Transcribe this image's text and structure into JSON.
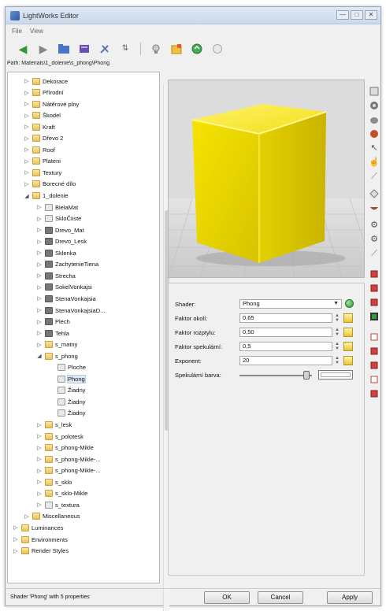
{
  "window": {
    "title": "LightWorks Editor",
    "controls": [
      "—",
      "□",
      "✕"
    ]
  },
  "menu": [
    "File",
    "View"
  ],
  "toolbar": {
    "icons": [
      "back-arrow-icon",
      "forward-arrow-icon",
      "open-folder-icon",
      "database-icon",
      "tools-icon",
      "sort-icon",
      "bulb-icon",
      "folder-new-icon",
      "refresh-icon",
      "disabled-icon"
    ]
  },
  "path": "Path: Materials\\1_dolenie\\s_phong\\Phong",
  "tree": {
    "items": [
      {
        "label": "Dekorace",
        "level": 2,
        "icon": "folder",
        "expander": "▷"
      },
      {
        "label": "Přírodní",
        "level": 2,
        "icon": "folder",
        "expander": "▷"
      },
      {
        "label": "Nátěrové plny",
        "level": 2,
        "icon": "folder",
        "expander": "▷"
      },
      {
        "label": "Škodel",
        "level": 2,
        "icon": "folder",
        "expander": "▷"
      },
      {
        "label": "Kraft",
        "level": 2,
        "icon": "folder",
        "expander": "▷"
      },
      {
        "label": "Dřevo 2",
        "level": 2,
        "icon": "folder",
        "expander": "▷"
      },
      {
        "label": "Roof",
        "level": 2,
        "icon": "folder",
        "expander": "▷"
      },
      {
        "label": "Plateni",
        "level": 2,
        "icon": "folder",
        "expander": "▷"
      },
      {
        "label": "Textury",
        "level": 2,
        "icon": "folder",
        "expander": "▷"
      },
      {
        "label": "Borecné dílo",
        "level": 2,
        "icon": "folder",
        "expander": "▷"
      },
      {
        "label": "1_dolenie",
        "level": 2,
        "icon": "folder",
        "expander": "◢"
      },
      {
        "label": "BielaMat",
        "level": 3,
        "icon": "sub",
        "expander": "▷"
      },
      {
        "label": "SkloČiiste",
        "level": 3,
        "icon": "sub",
        "expander": "▷"
      },
      {
        "label": "Drevo_Mat",
        "level": 3,
        "icon": "mat",
        "expander": "▷"
      },
      {
        "label": "Drevo_Lesk",
        "level": 3,
        "icon": "mat",
        "expander": "▷"
      },
      {
        "label": "Sklenka",
        "level": 3,
        "icon": "mat",
        "expander": "▷"
      },
      {
        "label": "ZachytenieTiena",
        "level": 3,
        "icon": "mat",
        "expander": "▷"
      },
      {
        "label": "Strecha",
        "level": 3,
        "icon": "mat",
        "expander": "▷"
      },
      {
        "label": "SokelVonkajsi",
        "level": 3,
        "icon": "mat",
        "expander": "▷"
      },
      {
        "label": "StenaVonkajsia",
        "level": 3,
        "icon": "mat",
        "expander": "▷"
      },
      {
        "label": "StenaVonkajsiaD...",
        "level": 3,
        "icon": "mat",
        "expander": "▷"
      },
      {
        "label": "Plech",
        "level": 3,
        "icon": "mat",
        "expander": "▷"
      },
      {
        "label": "Tehla",
        "level": 3,
        "icon": "mat",
        "expander": "▷"
      },
      {
        "label": "s_matny",
        "level": 3,
        "icon": "folder",
        "expander": "▷"
      },
      {
        "label": "s_phong",
        "level": 3,
        "icon": "folder",
        "expander": "◢"
      },
      {
        "label": "Ploche",
        "level": 4,
        "icon": "sub",
        "expander": ""
      },
      {
        "label": "Phong",
        "level": 4,
        "icon": "sub",
        "expander": "",
        "selected": true
      },
      {
        "label": "Žiadny",
        "level": 4,
        "icon": "sub",
        "expander": ""
      },
      {
        "label": "Žiadny",
        "level": 4,
        "icon": "sub",
        "expander": ""
      },
      {
        "label": "Žiadny",
        "level": 4,
        "icon": "sub",
        "expander": ""
      },
      {
        "label": "s_lesk",
        "level": 3,
        "icon": "folder",
        "expander": "▷"
      },
      {
        "label": "s_polotesk",
        "level": 3,
        "icon": "folder",
        "expander": "▷"
      },
      {
        "label": "s_phong-Mikle",
        "level": 3,
        "icon": "folder",
        "expander": "▷"
      },
      {
        "label": "s_phong-Mikle-...",
        "level": 3,
        "icon": "folder",
        "expander": "▷"
      },
      {
        "label": "s_phong-Mikle-...",
        "level": 3,
        "icon": "folder",
        "expander": "▷"
      },
      {
        "label": "s_sklo",
        "level": 3,
        "icon": "folder",
        "expander": "▷"
      },
      {
        "label": "s_sklo-Mikle",
        "level": 3,
        "icon": "folder",
        "expander": "▷"
      },
      {
        "label": "s_textura",
        "level": 3,
        "icon": "sub",
        "expander": "▷"
      },
      {
        "label": "Miscellaneous",
        "level": 2,
        "icon": "folder",
        "expander": "▷"
      },
      {
        "label": "Luminances",
        "level": 1,
        "icon": "folder",
        "expander": "▷"
      },
      {
        "label": "Environments",
        "level": 1,
        "icon": "folder",
        "expander": "▷"
      },
      {
        "label": "Render Styles",
        "level": 1,
        "icon": "folder",
        "expander": "▷"
      }
    ]
  },
  "properties": {
    "shader_label": "Shader:",
    "shader_value": "Phong",
    "rows": [
      {
        "label": "Faktor okolí:",
        "value": "0,65"
      },
      {
        "label": "Faktor rozptylu:",
        "value": "0,50"
      },
      {
        "label": "Faktor spekulární:",
        "value": "0,5"
      },
      {
        "label": "Exponent:",
        "value": "20"
      }
    ],
    "specular_color_label": "Spekulární barva:",
    "specular_slider": 0.92
  },
  "status": {
    "text": "Shader 'Phong' with 5 properties",
    "ok": "OK",
    "cancel": "Cancel",
    "apply": "Apply"
  },
  "right_toolbar": {
    "icons": [
      "sphere-icon",
      "torus-icon",
      "teapot-icon",
      "ball-icon",
      "cursor-icon",
      "pan-icon",
      "line-icon",
      "shape-icon",
      "bowl-icon",
      "gear-icon",
      "gear-icon",
      "measure-icon",
      "cube-red-icon",
      "cube-red-icon",
      "cube-red-icon",
      "cube-green-icon",
      "cube-outline-icon",
      "cube-red-icon",
      "cube-red-icon",
      "cube-red-icon",
      "cube-red-icon"
    ]
  },
  "colors": {
    "cube": "#f2de00",
    "accent_yellow": "#e6c43c",
    "selection": "#dde8f6"
  }
}
